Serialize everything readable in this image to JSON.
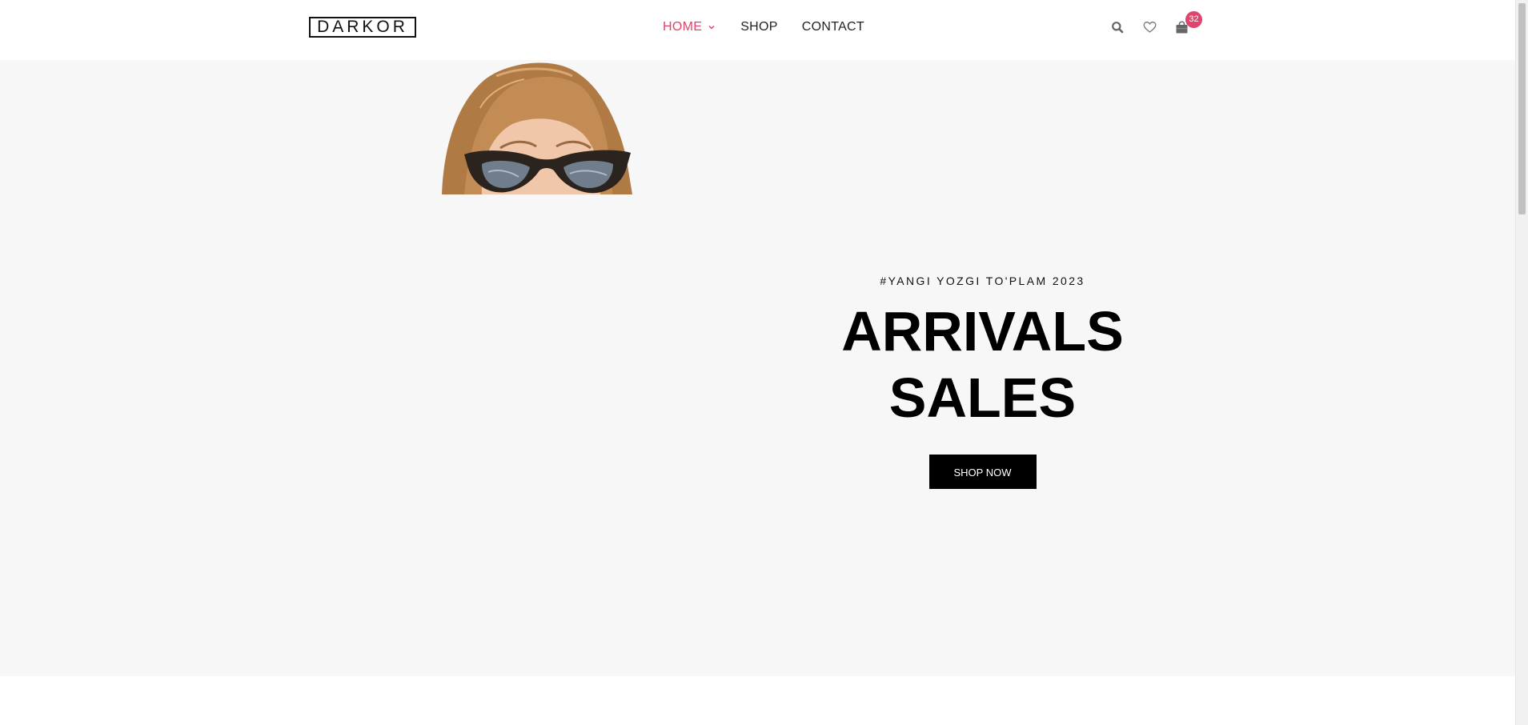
{
  "header": {
    "logo": "DARKOR",
    "nav": [
      {
        "label": "HOME",
        "active": true,
        "has_dropdown": true
      },
      {
        "label": "SHOP",
        "active": false,
        "has_dropdown": false
      },
      {
        "label": "CONTACT",
        "active": false,
        "has_dropdown": false
      }
    ],
    "icons": [
      "search-icon",
      "heart-icon",
      "shopping-bag-icon"
    ],
    "cart_count": "32"
  },
  "hero": {
    "tagline": "#YANGI YOZGI TO'PLAM 2023",
    "title_line1": "ARRIVALS",
    "title_line2": "SALES",
    "cta": "SHOP NOW"
  },
  "colors": {
    "accent": "#e0436b",
    "hero_bg": "#f7f7f7",
    "button_bg": "#000000"
  }
}
